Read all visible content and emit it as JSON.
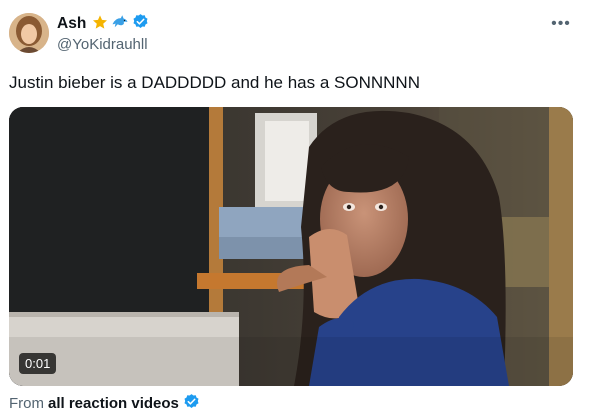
{
  "tweet": {
    "author_name": "Ash",
    "author_handle": "@YoKidrauhll",
    "badges": [
      "star-icon",
      "dolphin-icon",
      "verified-badge-icon"
    ],
    "text": "Justin bieber is a DADDDDD and he has a SONNNNN",
    "more_icon": "more-options-icon"
  },
  "media": {
    "type": "video",
    "timestamp": "0:01"
  },
  "attribution": {
    "prefix": "From",
    "source": "all reaction videos",
    "verified_icon": "verified-badge-icon",
    "verified_color": "#1d9bf0"
  }
}
